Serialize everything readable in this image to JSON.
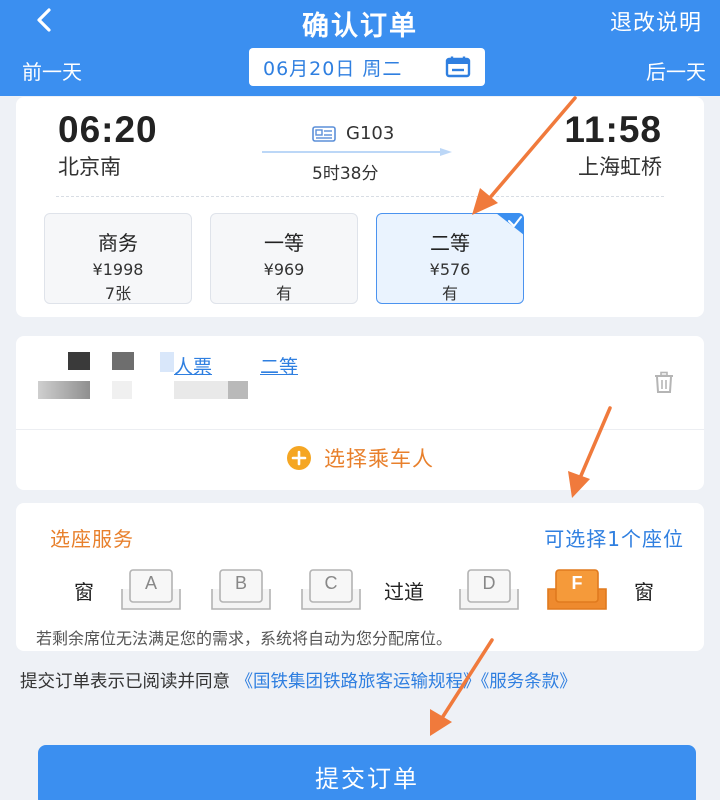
{
  "header": {
    "title": "确认订单",
    "refund_label": "退改说明",
    "prev_day": "前一天",
    "next_day": "后一天",
    "date": "06月20日 周二",
    "back_icon": "back-chevron-icon",
    "calendar_icon": "calendar-icon"
  },
  "train": {
    "departure_time": "06:20",
    "departure_station": "北京南",
    "arrival_time": "11:58",
    "arrival_station": "上海虹桥",
    "train_no": "G103",
    "duration": "5时38分",
    "seat_classes": [
      {
        "name": "商务",
        "price": "¥1998",
        "availability": "7张",
        "selected": false
      },
      {
        "name": "一等",
        "price": "¥969",
        "availability": "有",
        "selected": false
      },
      {
        "name": "二等",
        "price": "¥576",
        "availability": "有",
        "selected": true
      }
    ]
  },
  "passenger": {
    "ticket_type": "人票",
    "seat_type": "二等",
    "choose_label": "选择乘车人"
  },
  "seat_service": {
    "title": "选座服务",
    "limit_text": "可选择1个座位",
    "window_label": "窗",
    "aisle_label": "过道",
    "seats": [
      "A",
      "B",
      "C",
      "D",
      "F"
    ],
    "selected_seat": "F",
    "note": "若剩余席位无法满足您的需求，系统将自动为您分配席位。"
  },
  "agreement": {
    "prefix": "提交订单表示已阅读并同意 ",
    "link1": "《国铁集团铁路旅客运输规程》",
    "link2": "《服务条款》"
  },
  "submit_label": "提交订单",
  "colors": {
    "primary": "#3b8ff0",
    "link": "#2f7fe0",
    "accent_orange": "#e8802c",
    "arrow": "#f07a3c"
  }
}
